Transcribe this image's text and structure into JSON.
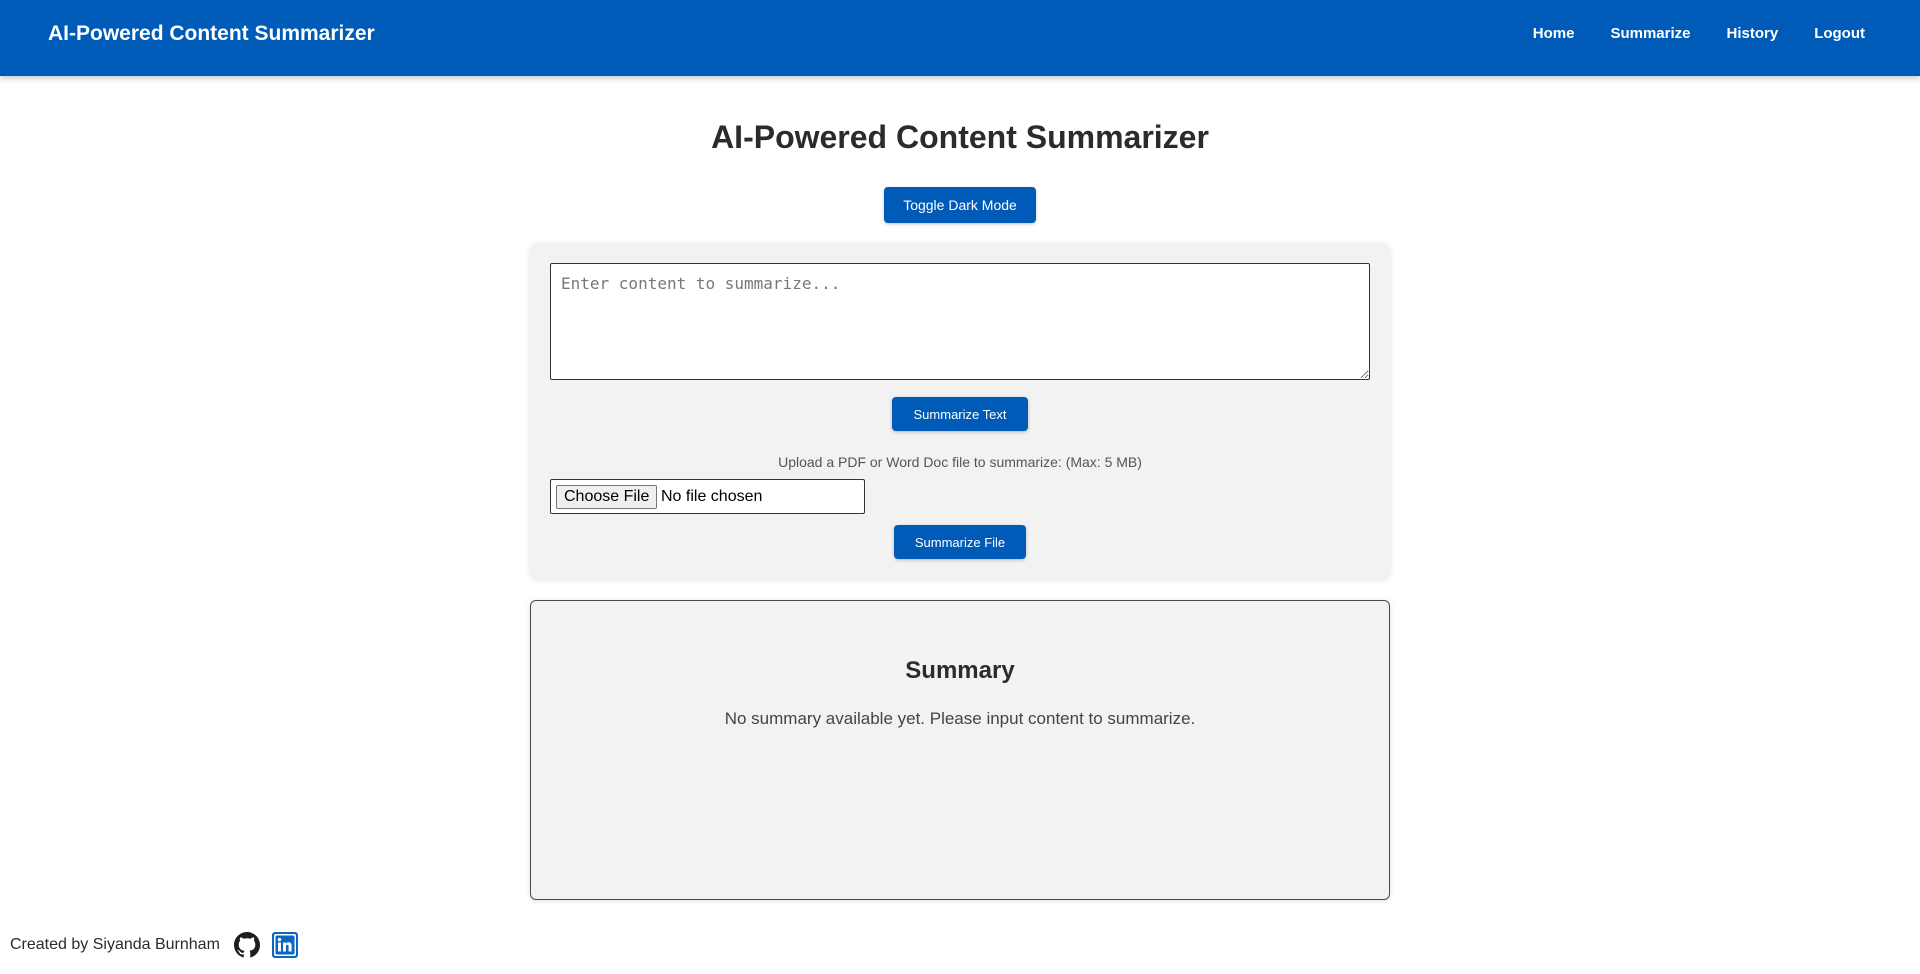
{
  "nav": {
    "brand": "AI-Powered Content Summarizer",
    "links": [
      "Home",
      "Summarize",
      "History",
      "Logout"
    ]
  },
  "main": {
    "title": "AI-Powered Content Summarizer",
    "toggle_label": "Toggle Dark Mode"
  },
  "input_card": {
    "textarea_placeholder": "Enter content to summarize...",
    "textarea_value": "",
    "summarize_text_label": "Summarize Text",
    "upload_label": "Upload a PDF or Word Doc file to summarize: (Max: 5 MB)",
    "choose_file_label": "Choose File",
    "file_status": "No file chosen",
    "summarize_file_label": "Summarize File"
  },
  "summary": {
    "title": "Summary",
    "text": "No summary available yet. Please input content to summarize."
  },
  "footer": {
    "credit": "Created by Siyanda Burnham",
    "icons": [
      "github-icon",
      "linkedin-icon"
    ]
  },
  "colors": {
    "primary": "#005bb8",
    "card_bg": "#f2f2f2",
    "linkedin": "#0a66c2"
  }
}
